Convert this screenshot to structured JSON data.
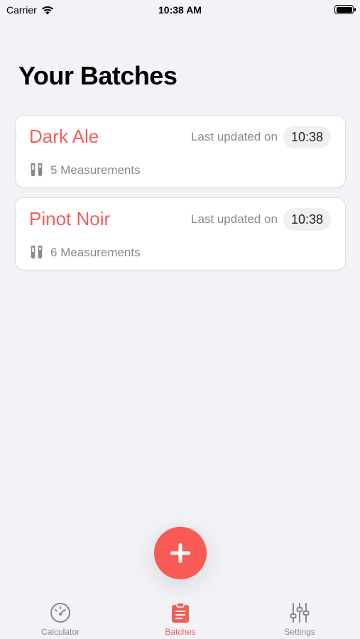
{
  "status_bar": {
    "carrier": "Carrier",
    "time": "10:38 AM"
  },
  "page": {
    "title": "Your Batches"
  },
  "batches": [
    {
      "name": "Dark Ale",
      "updated_label": "Last updated on",
      "updated_time": "10:38",
      "measurements": "5 Measurements"
    },
    {
      "name": "Pinot Noir",
      "updated_label": "Last updated on",
      "updated_time": "10:38",
      "measurements": "6 Measurements"
    }
  ],
  "fab": {
    "icon": "plus-icon"
  },
  "tab_bar": {
    "tabs": [
      {
        "label": "Calculator",
        "icon": "gauge-icon",
        "active": false
      },
      {
        "label": "Batches",
        "icon": "clipboard-icon",
        "active": true
      },
      {
        "label": "Settings",
        "icon": "sliders-icon",
        "active": false
      }
    ]
  },
  "colors": {
    "accent": "#f0605a",
    "fab": "#f85a55",
    "background": "#f2f2f7",
    "secondary_text": "#8a8a8e"
  }
}
